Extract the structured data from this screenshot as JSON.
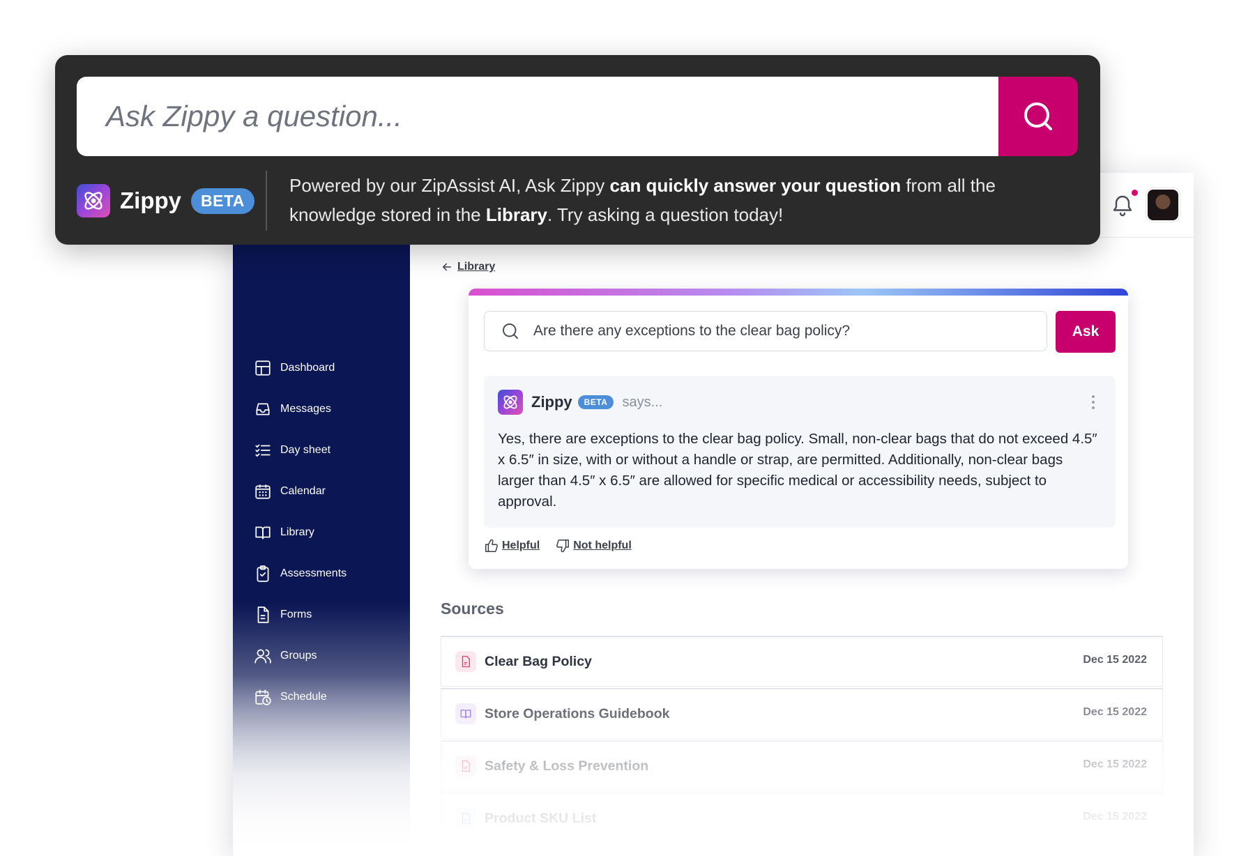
{
  "overlay": {
    "search_placeholder": "Ask Zippy a question...",
    "brand_name": "Zippy",
    "beta_badge": "BETA",
    "description_parts": [
      "Powered by our ZipAssist AI, Ask Zippy ",
      "can quickly answer your question",
      " from all the knowledge stored in the ",
      "Library",
      ". Try asking a question today!"
    ]
  },
  "sidebar": {
    "items": [
      {
        "label": "Dashboard",
        "icon": "dashboard-icon"
      },
      {
        "label": "Messages",
        "icon": "inbox-icon"
      },
      {
        "label": "Day sheet",
        "icon": "checklist-icon"
      },
      {
        "label": "Calendar",
        "icon": "calendar-icon"
      },
      {
        "label": "Library",
        "icon": "book-icon"
      },
      {
        "label": "Assessments",
        "icon": "clipboard-check-icon"
      },
      {
        "label": "Forms",
        "icon": "document-icon"
      },
      {
        "label": "Groups",
        "icon": "users-icon"
      },
      {
        "label": "Schedule",
        "icon": "calendar-clock-icon"
      }
    ]
  },
  "breadcrumb": {
    "label": "Library"
  },
  "card": {
    "question": "Are there any exceptions to the clear bag policy?",
    "ask_label": "Ask",
    "answer": {
      "name": "Zippy",
      "beta_badge": "BETA",
      "says": "says...",
      "text": "Yes, there are exceptions to the clear bag policy. Small, non-clear bags that do not exceed 4.5″ x 6.5″ in size, with or without a handle or strap, are permitted. Additionally, non-clear bags larger than 4.5″ x 6.5″ are allowed for specific medical or accessibility needs, subject to approval."
    },
    "helpful_label": "Helpful",
    "not_helpful_label": "Not helpful"
  },
  "sources": {
    "title": "Sources",
    "rows": [
      {
        "title": "Clear Bag Policy",
        "date": "Dec 15 2022",
        "icon": "pdf-icon",
        "color": "#e23b6e"
      },
      {
        "title": "Store Operations Guidebook",
        "date": "Dec 15 2022",
        "icon": "book-icon",
        "color": "#7a4fd6"
      },
      {
        "title": "Safety & Loss Prevention",
        "date": "Dec 15 2022",
        "icon": "pdf-icon",
        "color": "#e23b6e"
      },
      {
        "title": "Product SKU List",
        "date": "Dec 15 2022",
        "icon": "document-icon",
        "color": "#3a7bd5"
      }
    ]
  },
  "colors": {
    "accent": "#c8006e",
    "sidebar": "#0b1654",
    "beta": "#4d8ed8",
    "overlay": "#2b2b2b"
  }
}
